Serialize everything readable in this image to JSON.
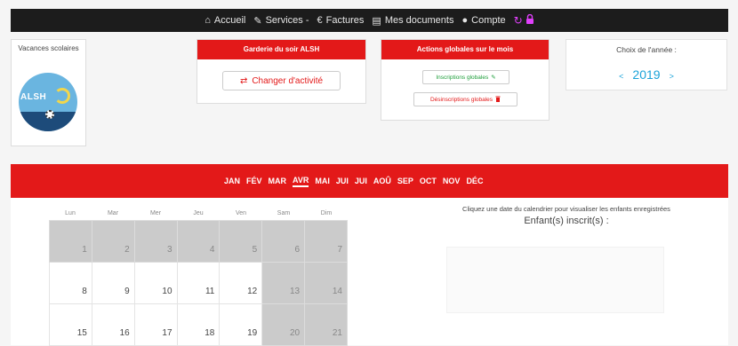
{
  "nav": {
    "items": [
      {
        "icon": "home-icon",
        "glyph": "🏠",
        "label": "Accueil"
      },
      {
        "icon": "pencil-icon",
        "glyph": "✎",
        "label": "Services -"
      },
      {
        "icon": "euro-icon",
        "glyph": "€",
        "label": "Factures"
      },
      {
        "icon": "document-icon",
        "glyph": "▤",
        "label": "Mes documents"
      },
      {
        "icon": "user-icon",
        "glyph": "👤",
        "label": "Compte"
      }
    ]
  },
  "vacances": {
    "title": "Vacances scolaires",
    "logo_text": "ALSH"
  },
  "garderie": {
    "title": "Garderie du soir ALSH",
    "button_label": "Changer d'activité"
  },
  "actions": {
    "title": "Actions globales sur le mois",
    "inscriptions_label": "Inscriptions globales",
    "desinscriptions_label": "Désinscriptions globales"
  },
  "year": {
    "title": "Choix de l'année :",
    "prev": "<",
    "value": "2019",
    "next": ">"
  },
  "months": [
    "JAN",
    "FÉV",
    "MAR",
    "AVR",
    "MAI",
    "JUI",
    "JUI",
    "AOÛ",
    "SEP",
    "OCT",
    "NOV",
    "DÉC"
  ],
  "active_month": "AVR",
  "calendar": {
    "day_headers": [
      "Lun",
      "Mar",
      "Mer",
      "Jeu",
      "Ven",
      "Sam",
      "Dim"
    ],
    "weeks": [
      [
        "1",
        "2",
        "3",
        "4",
        "5",
        "6",
        "7"
      ],
      [
        "8",
        "9",
        "10",
        "11",
        "12",
        "13",
        "14"
      ],
      [
        "15",
        "16",
        "17",
        "18",
        "19",
        "20",
        "21"
      ]
    ]
  },
  "right_panel": {
    "hint": "Cliquez une date du calendrier pour visualiser les enfants enregistrées",
    "heading": "Enfant(s) inscrit(s) :"
  },
  "colors": {
    "brand_red": "#e31919",
    "accent_blue": "#1aa3d9",
    "green": "#1e9e3a"
  }
}
